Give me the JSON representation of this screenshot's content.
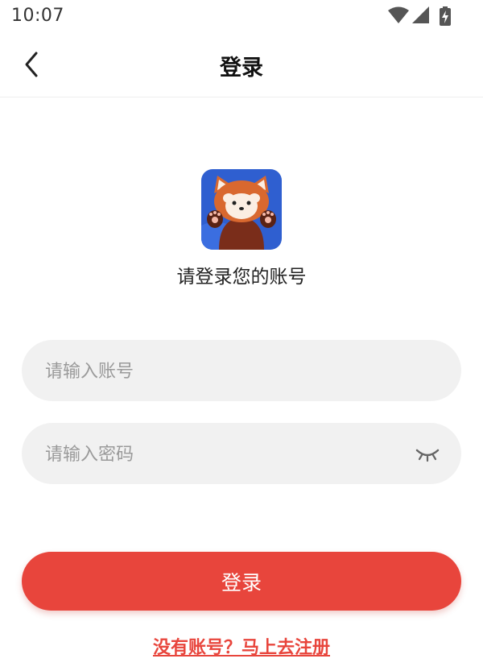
{
  "status_bar": {
    "time": "10:07",
    "icons": [
      "wifi-icon",
      "cellular-signal-icon",
      "battery-charging-icon"
    ]
  },
  "header": {
    "title": "登录",
    "back_icon": "chevron-left-icon"
  },
  "main": {
    "subtitle": "请登录您的账号",
    "account_placeholder": "请输入账号",
    "password_placeholder": "请输入密码",
    "password_toggle_icon": "eye-closed-icon",
    "login_label": "登录",
    "register_link": "没有账号？马上去注册"
  },
  "colors": {
    "accent": "#e8453c",
    "input_bg": "#f1f1f1",
    "avatar_bg": "#2f5fd0"
  }
}
